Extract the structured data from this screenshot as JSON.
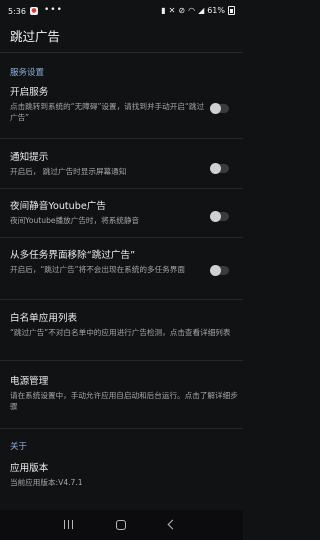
{
  "status_bar": {
    "time": "5:36",
    "notification_glyph": "●",
    "more": "•••",
    "battery_percent": "61%",
    "icons": [
      "app-notification-icon",
      "sim-icon",
      "mute-icon",
      "no-signal-icon",
      "wifi-icon",
      "signal-icon",
      "battery-icon"
    ]
  },
  "app_bar": {
    "title": "跳过广告"
  },
  "sections": {
    "service": {
      "header": "服务设置"
    },
    "about": {
      "header": "关于"
    }
  },
  "settings": {
    "enable_service": {
      "title": "开启服务",
      "summary": "点击跳转到系统的“无障碍”设置，请找到并手动开启“跳过广告”",
      "switch_on": false
    },
    "notification": {
      "title": "通知提示",
      "summary": "开启后， 跳过广告时显示屏幕通知",
      "switch_on": false
    },
    "night_mute_youtube": {
      "title": "夜间静音Youtube广告",
      "summary": "夜间Youtube播放广告时，将系统静音",
      "switch_on": false
    },
    "hide_from_recents": {
      "title": "从多任务界面移除“跳过广告”",
      "summary": "开启后，“跳过广告”将不会出现在系统的多任务界面",
      "switch_on": false
    },
    "whitelist": {
      "title": "白名单应用列表",
      "summary": "“跳过广告”不对白名单中的应用进行广告检测，点击查看详细列表"
    },
    "power_management": {
      "title": "电源管理",
      "summary": "请在系统设置中，手动允许应用自启动和后台运行。点击了解详细步骤"
    },
    "app_version": {
      "title": "应用版本",
      "summary": "当前应用版本:V4.7.1"
    }
  },
  "colors": {
    "background": "#111214",
    "section_header": "#8fb0d9",
    "switch_off_track": "#3a3b3f",
    "switch_off_knob": "#cfd0d3"
  }
}
